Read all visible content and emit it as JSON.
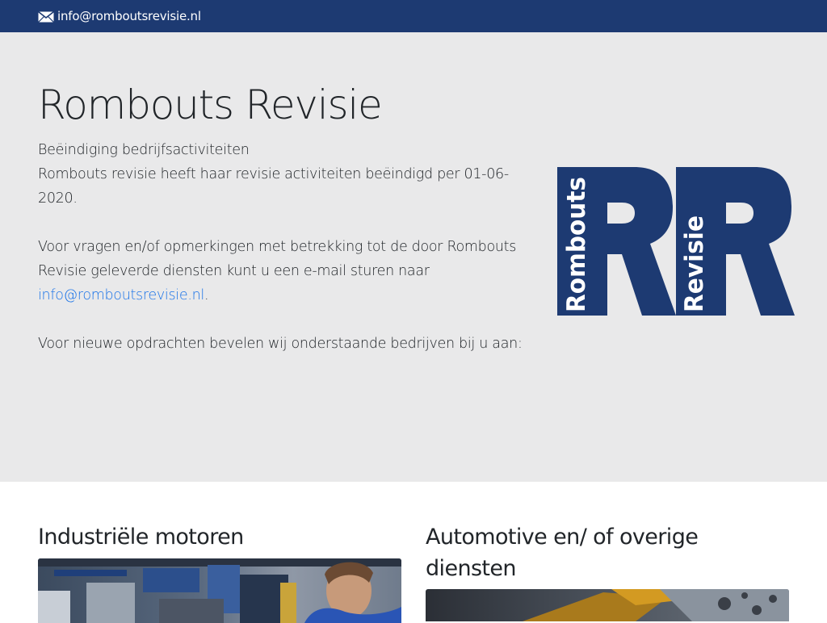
{
  "topbar": {
    "email": "info@romboutsrevisie.nl",
    "icon": "envelope-icon",
    "background": "#1d3a72"
  },
  "hero": {
    "title": "Rombouts Revisie",
    "paragraph1_line1": "Beëindiging bedrijfsactiviteiten",
    "paragraph1_line2": "Rombouts revisie heeft haar revisie activiteiten beëindigd per 01-06-2020.",
    "paragraph2_text": "Voor vragen en/of opmerkingen met betrekking tot de door Rombouts Revisie geleverde diensten kunt u een e-mail sturen naar",
    "paragraph2_link": "info@romboutsrevisie.nl",
    "paragraph2_end": ".",
    "paragraph3": "Voor nieuwe opdrachten bevelen wij onderstaande bedrijven bij u aan:",
    "background": "#e9e9ea",
    "link_color": "#1a73e8"
  },
  "logo": {
    "word1": "Rombouts",
    "word2": "Revisie",
    "color": "#1d3a72"
  },
  "services": [
    {
      "title": "Industriële motoren"
    },
    {
      "title": "Automotive en/ of overige diensten"
    }
  ]
}
